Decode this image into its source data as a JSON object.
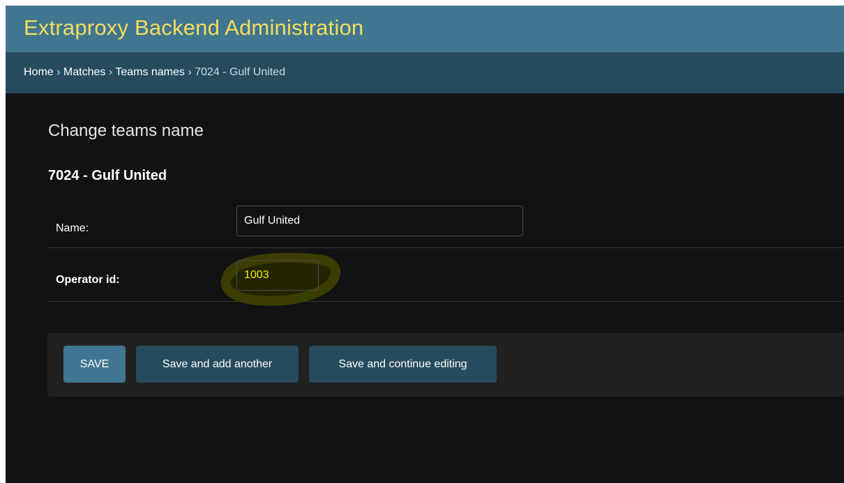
{
  "header": {
    "site_title": "Extraproxy Backend Administration"
  },
  "breadcrumbs": {
    "home": "Home",
    "app": "Matches",
    "model": "Teams names",
    "current": "7024 - Gulf United",
    "separator": " › "
  },
  "content": {
    "page_title": "Change teams name",
    "object_heading": "7024 - Gulf United"
  },
  "form": {
    "name": {
      "label": "Name:",
      "value": "Gulf United"
    },
    "operator_id": {
      "label": "Operator id:",
      "value": "1003"
    }
  },
  "actions": {
    "save": "SAVE",
    "save_add": "Save and add another",
    "save_continue": "Save and continue editing"
  },
  "colors": {
    "header_bg": "#417690",
    "breadcrumbs_bg": "#264b5d",
    "site_title": "#f5dd5d",
    "page_bg": "#121212",
    "primary_button": "#417690",
    "secondary_button": "#264b5d",
    "operator_value": "#f0f000"
  }
}
